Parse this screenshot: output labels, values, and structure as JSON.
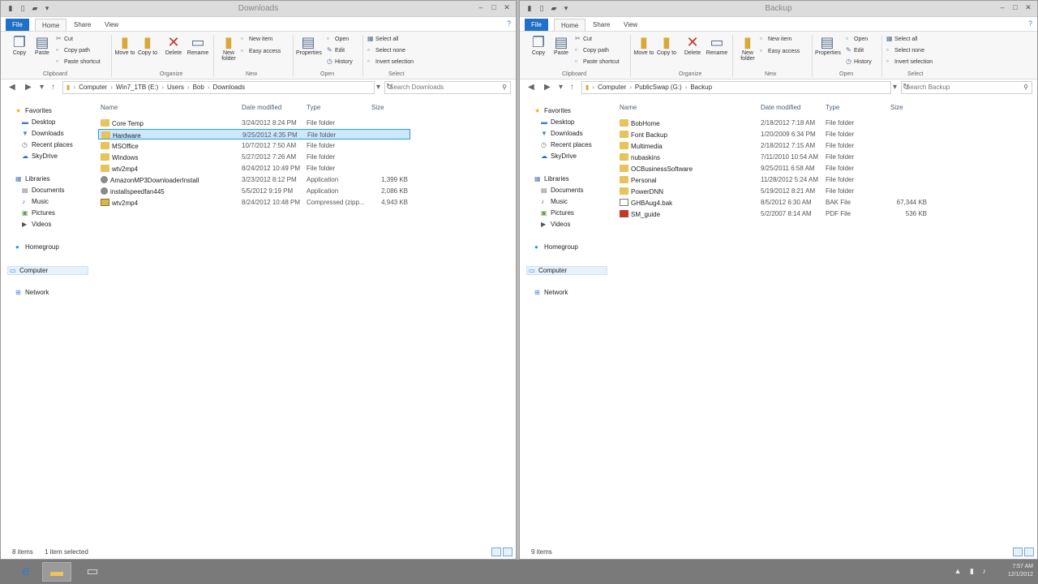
{
  "windows": [
    {
      "id": "left",
      "title": "Downloads",
      "tabs": {
        "file": "File",
        "home": "Home",
        "share": "Share",
        "view": "View"
      },
      "ribbon": {
        "copy": "Copy",
        "paste": "Paste",
        "cut": "Cut",
        "copy_path": "Copy path",
        "paste_shortcut": "Paste shortcut",
        "move_to": "Move to",
        "copy_to": "Copy to",
        "delete": "Delete",
        "rename": "Rename",
        "new_folder": "New folder",
        "new_item": "New item",
        "easy_access": "Easy access",
        "properties": "Properties",
        "open": "Open",
        "edit": "Edit",
        "history": "History",
        "select_all": "Select all",
        "select_none": "Select none",
        "invert_selection": "Invert selection",
        "groups": {
          "clipboard": "Clipboard",
          "organize": "Organize",
          "new": "New",
          "open": "Open",
          "select": "Select"
        }
      },
      "address": [
        "Computer",
        "Win7_1TB (E:)",
        "Users",
        "Bob",
        "Downloads"
      ],
      "search_placeholder": "Search Downloads",
      "nav": {
        "favorites": "Favorites",
        "desktop": "Desktop",
        "downloads": "Downloads",
        "recent": "Recent places",
        "skydrive": "SkyDrive",
        "libraries": "Libraries",
        "documents": "Documents",
        "music": "Music",
        "pictures": "Pictures",
        "videos": "Videos",
        "homegroup": "Homegroup",
        "computer": "Computer",
        "network": "Network"
      },
      "columns": {
        "name": "Name",
        "date": "Date modified",
        "type": "Type",
        "size": "Size"
      },
      "files": [
        {
          "name": "Core Temp",
          "date": "3/24/2012 8:24 PM",
          "type": "File folder",
          "size": ""
        },
        {
          "name": "Hardware",
          "date": "9/25/2012 4:35 PM",
          "type": "File folder",
          "size": ""
        },
        {
          "name": "MSOffice",
          "date": "10/7/2012 7:50 AM",
          "type": "File folder",
          "size": ""
        },
        {
          "name": "Windows",
          "date": "5/27/2012 7:26 AM",
          "type": "File folder",
          "size": ""
        },
        {
          "name": "wtv2mp4",
          "date": "8/24/2012 10:49 PM",
          "type": "File folder",
          "size": ""
        },
        {
          "name": "AmazonMP3DownloaderInstall",
          "date": "3/23/2012 8:12 PM",
          "type": "Application",
          "size": "1,399 KB"
        },
        {
          "name": "installspeedfan445",
          "date": "5/5/2012 9:19 PM",
          "type": "Application",
          "size": "2,086 KB"
        },
        {
          "name": "wtv2mp4",
          "date": "8/24/2012 10:48 PM",
          "type": "Compressed (zipp...",
          "size": "4,943 KB"
        }
      ],
      "status": {
        "count": "8 items",
        "selected": "1 item selected"
      }
    },
    {
      "id": "right",
      "title": "Backup",
      "tabs": {
        "file": "File",
        "home": "Home",
        "share": "Share",
        "view": "View"
      },
      "ribbon": {
        "copy": "Copy",
        "paste": "Paste",
        "cut": "Cut",
        "copy_path": "Copy path",
        "paste_shortcut": "Paste shortcut",
        "move_to": "Move to",
        "copy_to": "Copy to",
        "delete": "Delete",
        "rename": "Rename",
        "new_folder": "New folder",
        "new_item": "New item",
        "easy_access": "Easy access",
        "properties": "Properties",
        "open": "Open",
        "edit": "Edit",
        "history": "History",
        "select_all": "Select all",
        "select_none": "Select none",
        "invert_selection": "Invert selection",
        "groups": {
          "clipboard": "Clipboard",
          "organize": "Organize",
          "new": "New",
          "open": "Open",
          "select": "Select"
        }
      },
      "address": [
        "Computer",
        "PublicSwap (G:)",
        "Backup"
      ],
      "search_placeholder": "Search Backup",
      "nav": {
        "favorites": "Favorites",
        "desktop": "Desktop",
        "downloads": "Downloads",
        "recent": "Recent places",
        "skydrive": "SkyDrive",
        "libraries": "Libraries",
        "documents": "Documents",
        "music": "Music",
        "pictures": "Pictures",
        "videos": "Videos",
        "homegroup": "Homegroup",
        "computer": "Computer",
        "network": "Network"
      },
      "columns": {
        "name": "Name",
        "date": "Date modified",
        "type": "Type",
        "size": "Size"
      },
      "files": [
        {
          "name": "BobHome",
          "date": "2/18/2012 7:18 AM",
          "type": "File folder",
          "size": ""
        },
        {
          "name": "Font Backup",
          "date": "1/20/2009 6:34 PM",
          "type": "File folder",
          "size": ""
        },
        {
          "name": "Multimedia",
          "date": "2/18/2012 7:15 AM",
          "type": "File folder",
          "size": ""
        },
        {
          "name": "nubaskins",
          "date": "7/11/2010 10:54 AM",
          "type": "File folder",
          "size": ""
        },
        {
          "name": "OCBusinessSoftware",
          "date": "9/25/2011 6:58 AM",
          "type": "File folder",
          "size": ""
        },
        {
          "name": "Personal",
          "date": "11/28/2012 5:24 AM",
          "type": "File folder",
          "size": ""
        },
        {
          "name": "PowerDNN",
          "date": "5/19/2012 8:21 AM",
          "type": "File folder",
          "size": ""
        },
        {
          "name": "GHBAug4.bak",
          "date": "8/5/2012 6:30 AM",
          "type": "BAK File",
          "size": "67,344 KB"
        },
        {
          "name": "SM_guide",
          "date": "5/2/2007 8:14 AM",
          "type": "PDF File",
          "size": "536 KB"
        }
      ],
      "status": {
        "count": "9 items",
        "selected": ""
      }
    }
  ],
  "taskbar": {
    "clock_time": "7:57 AM",
    "clock_date": "12/1/2012"
  },
  "selected_row": {
    "window": "left",
    "index": 1
  },
  "colors": {
    "file_tab": "#1e70c8",
    "selection": "#cce8ff",
    "taskbar": "#7a7a7a"
  }
}
